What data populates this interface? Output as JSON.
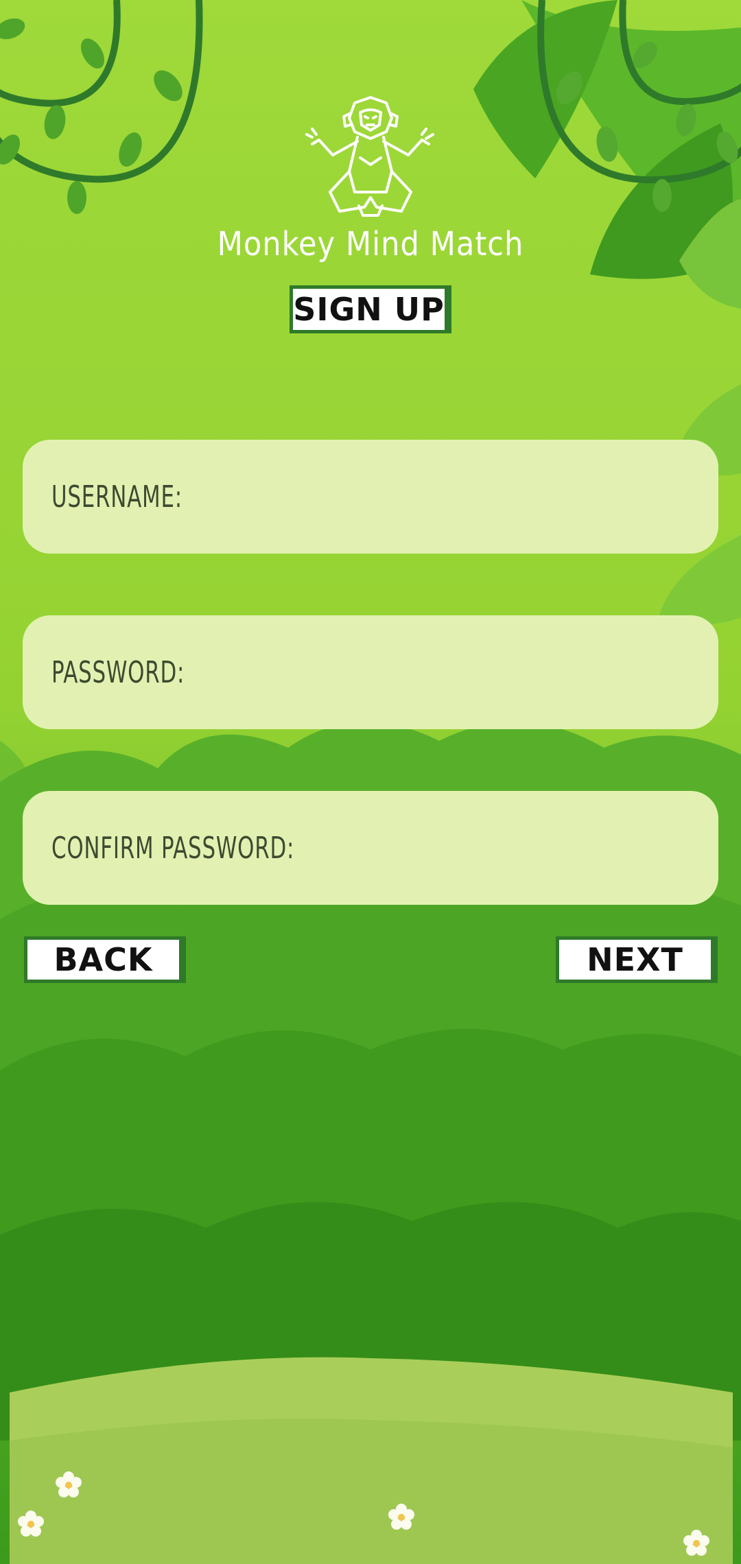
{
  "app": {
    "title": "Monkey Mind Match",
    "logo_icon": "meditating-monkey-icon"
  },
  "screen": {
    "heading": "SIGN UP"
  },
  "form": {
    "username": {
      "label": "USERNAME:",
      "value": ""
    },
    "password": {
      "label": "PASSWORD:",
      "value": ""
    },
    "confirm_password": {
      "label": "CONFIRM PASSWORD:",
      "value": ""
    }
  },
  "nav": {
    "back_label": "BACK",
    "next_label": "NEXT"
  },
  "colors": {
    "background": "#8cd02e",
    "field_fill": "#e2f1b2",
    "button_border": "#2f7a2a",
    "text_dark": "#111111"
  }
}
